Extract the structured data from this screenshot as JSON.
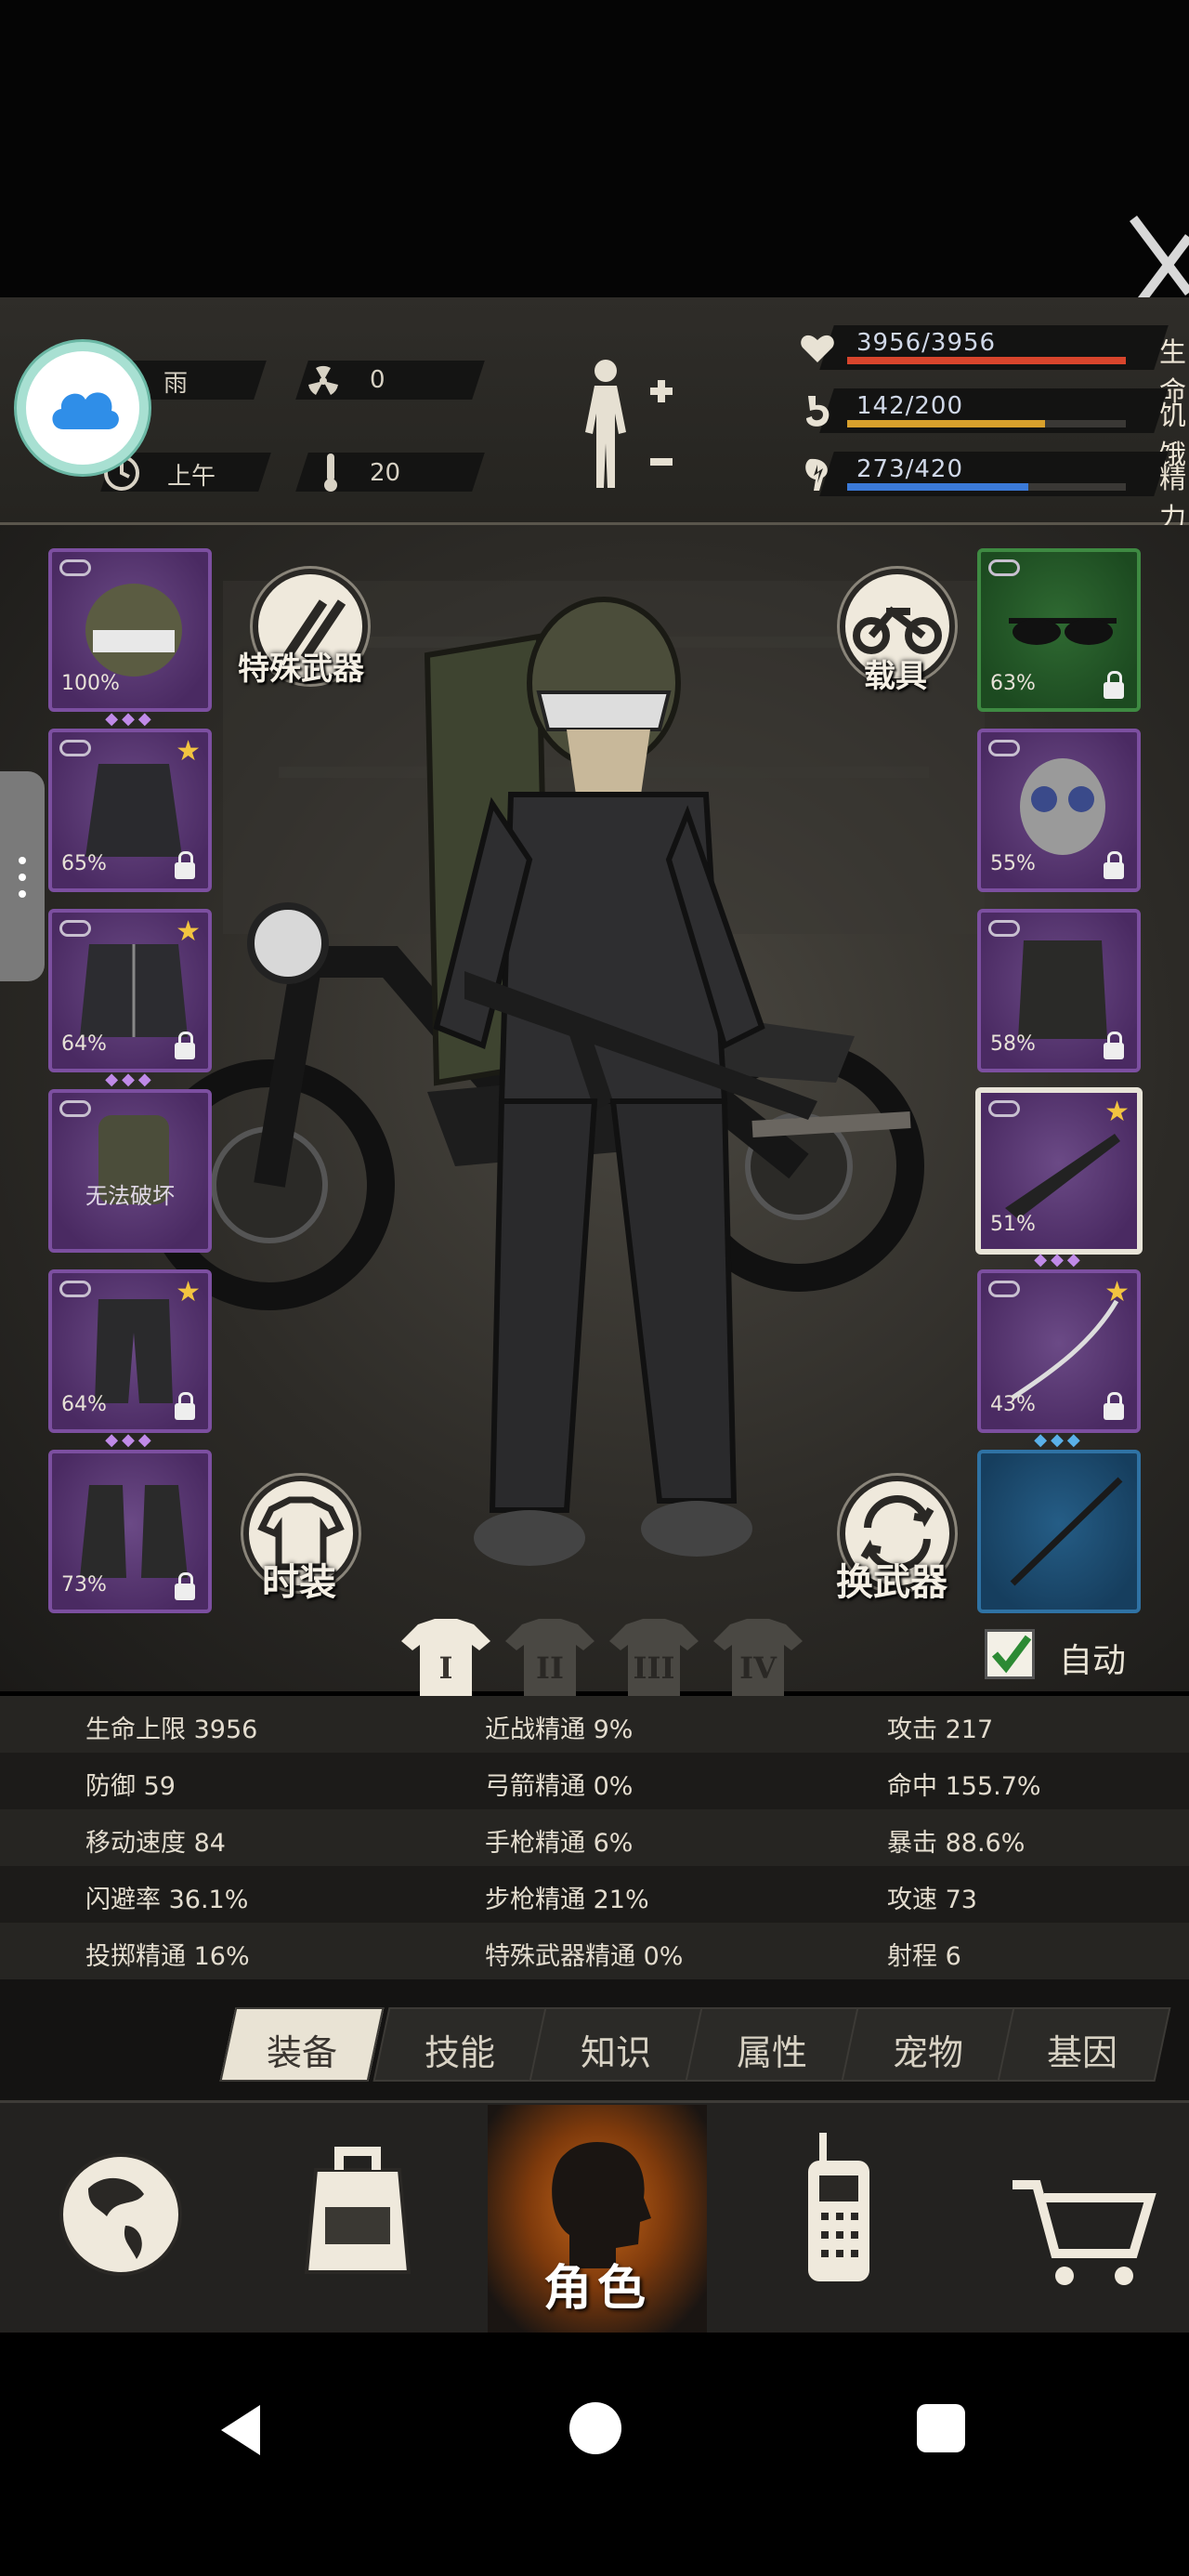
{
  "status": {
    "weather": "雨",
    "radiation": "0",
    "time_of_day": "上午",
    "temperature": "20",
    "bars": [
      {
        "label": "生命",
        "value": "3956/3956",
        "fraction": 1.0,
        "color": "#d8452c",
        "icon": "heart-icon"
      },
      {
        "label": "饥饿",
        "value": "142/200",
        "fraction": 0.71,
        "color": "#d8a02c",
        "icon": "stomach-icon"
      },
      {
        "label": "精力",
        "value": "273/420",
        "fraction": 0.65,
        "color": "#3b7ad8",
        "icon": "energy-icon"
      }
    ]
  },
  "left_slots": [
    {
      "name": "helmet",
      "pct": "100%",
      "gems": "◆◆◆",
      "star": false
    },
    {
      "name": "shirt",
      "pct": "65%",
      "gems": "",
      "star": true
    },
    {
      "name": "jacket",
      "pct": "64%",
      "gems": "◆◆◆",
      "star": true
    },
    {
      "name": "backpack",
      "pct": "",
      "note": "无法破坏",
      "gems": "",
      "star": false
    },
    {
      "name": "pants",
      "pct": "64%",
      "gems": "◆◆◆",
      "star": true
    },
    {
      "name": "boots",
      "pct": "73%",
      "gems": "",
      "star": false
    }
  ],
  "right_slots": [
    {
      "name": "glasses",
      "pct": "63%",
      "gems": "",
      "star": false
    },
    {
      "name": "gas-mask",
      "pct": "55%",
      "gems": "",
      "star": false
    },
    {
      "name": "vest",
      "pct": "58%",
      "gems": "",
      "star": false
    },
    {
      "name": "rifle",
      "pct": "51%",
      "gems": "◆◆◆",
      "star": true
    },
    {
      "name": "katana",
      "pct": "43%",
      "gems": "◆◆◆",
      "star": true
    },
    {
      "name": "spear",
      "pct": "",
      "gems": "",
      "star": false
    }
  ],
  "buttons": {
    "special_weapon": "特殊武器",
    "vehicle": "载具",
    "fashion": "时装",
    "swap_weapon": "换武器",
    "auto": "自动"
  },
  "loadouts": [
    "I",
    "II",
    "III",
    "IV"
  ],
  "stats": [
    [
      "生命上限 3956",
      "近战精通 9%",
      "攻击 217"
    ],
    [
      "防御 59",
      "弓箭精通 0%",
      "命中 155.7%"
    ],
    [
      "移动速度 84",
      "手枪精通 6%",
      "暴击 88.6%"
    ],
    [
      "闪避率 36.1%",
      "步枪精通 21%",
      "攻速 73"
    ],
    [
      "投掷精通 16%",
      "特殊武器精通 0%",
      "射程 6"
    ]
  ],
  "tabs": [
    "装备",
    "技能",
    "知识",
    "属性",
    "宠物",
    "基因"
  ],
  "nav": {
    "active_label": "角色"
  },
  "colors": {
    "purple_slot": "#4a2a62",
    "green_slot": "#1c4a20",
    "blue_slot": "#163e5e",
    "accent_orange": "#c8681a"
  }
}
